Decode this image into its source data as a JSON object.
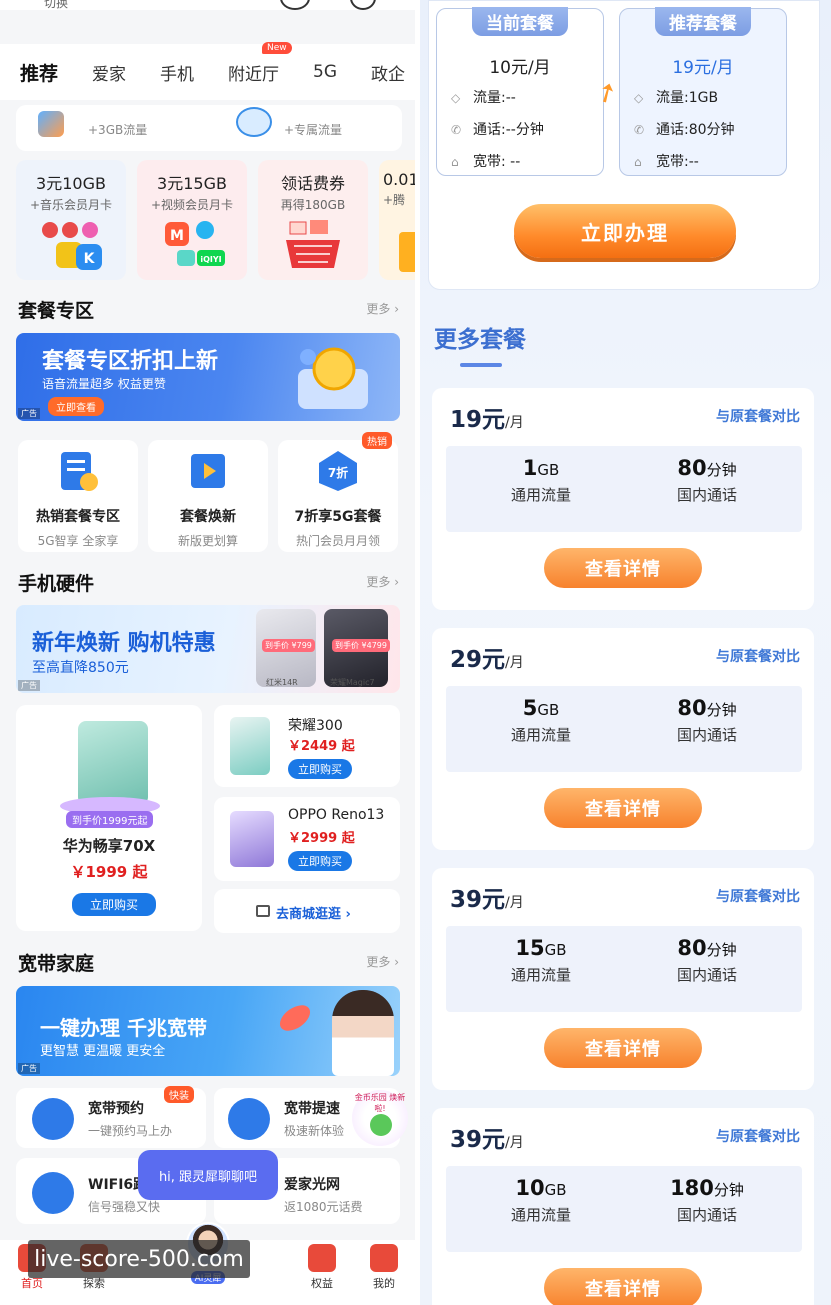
{
  "left": {
    "top": {
      "switch": "切换"
    },
    "tabs": [
      "推荐",
      "爱家",
      "手机",
      "附近厅",
      "5G",
      "政企"
    ],
    "new_badge": "New",
    "promo_row1": {
      "left_sub": "+3GB流量",
      "right_sub": "+专属流量"
    },
    "promo_tiles": [
      {
        "title": "3元10GB",
        "sub": "+音乐会员月卡"
      },
      {
        "title": "3元15GB",
        "sub": "+视频会员月卡"
      },
      {
        "title": "领话费券",
        "sub": "再得180GB"
      },
      {
        "title": "0.01",
        "sub": "+腾"
      }
    ],
    "iqiyi": "iQIYI",
    "plan_section": {
      "title": "套餐专区",
      "more": "更多 ›"
    },
    "plan_banner": {
      "title": "套餐专区折扣上新",
      "sub": "语音流量超多 权益更赞",
      "btn": "立即查看",
      "ad": "广告"
    },
    "services": [
      {
        "name": "热销套餐专区",
        "sub": "5G智享 全家享"
      },
      {
        "name": "套餐焕新",
        "sub": "新版更划算"
      },
      {
        "name": "7折享5G套餐",
        "sub": "热门会员月月领",
        "tag": "热销",
        "icon_text": "7折"
      }
    ],
    "hw_section": {
      "title": "手机硬件",
      "more": "更多 ›"
    },
    "hw_banner": {
      "title": "新年焕新 购机特惠",
      "sub": "至高直降850元",
      "ad": "广告",
      "tag1": "到手价 ¥799",
      "tag2": "到手价 ¥4799",
      "phone1": "红米14R",
      "phone2": "荣耀Magic7"
    },
    "phones": {
      "big": {
        "name": "华为畅享70X",
        "price": "￥1999 起",
        "promo": "到手价1999元起",
        "btn": "立即购买"
      },
      "p1": {
        "name": "荣耀300",
        "price": "￥2449 起",
        "btn": "立即购买"
      },
      "p2": {
        "name": "OPPO Reno13",
        "price": "￥2999 起",
        "btn": "立即购买"
      },
      "mall": "去商城逛逛 ›"
    },
    "bb_section": {
      "title": "宽带家庭",
      "more": "更多 ›"
    },
    "bb_banner": {
      "title": "一键办理 千兆宽带",
      "sub": "更智慧  更温暖  更安全",
      "ad": "广告"
    },
    "bb_items": [
      {
        "name": "宽带预约",
        "sub": "一键预约马上办",
        "tag": "快装"
      },
      {
        "name": "宽带提速",
        "sub": "极速新体验"
      },
      {
        "name": "WIFI6路",
        "sub": "信号强稳又快"
      },
      {
        "name": "爱家光网",
        "sub": "返1080元话费"
      }
    ],
    "gold_tag": "金币乐园 焕新啦!",
    "chat": "hi, 跟灵犀聊聊吧",
    "ai_label": "AI灵犀",
    "bottom_nav": [
      "首页",
      "探索",
      "权益",
      "我的"
    ],
    "watermark": "live-score-500.com"
  },
  "right": {
    "current": {
      "header": "当前套餐",
      "price": "10元/月",
      "flow": "流量:--",
      "call": "通话:--分钟",
      "broadband": "宽带: --"
    },
    "recommended": {
      "header": "推荐套餐",
      "price": "19元/月",
      "flow": "流量:1GB",
      "call": "通话:80分钟",
      "broadband": "宽带:--"
    },
    "apply_btn": "立即办理",
    "more_title": "更多套餐",
    "compare": "与原套餐对比",
    "detail_btn": "查看详情",
    "flow_label": "通用流量",
    "call_label": "国内通话",
    "plans": [
      {
        "price": "19元",
        "unit": "/月",
        "flow": "1",
        "flow_unit": "GB",
        "call": "80",
        "call_unit": "分钟"
      },
      {
        "price": "29元",
        "unit": "/月",
        "flow": "5",
        "flow_unit": "GB",
        "call": "80",
        "call_unit": "分钟"
      },
      {
        "price": "39元",
        "unit": "/月",
        "flow": "15",
        "flow_unit": "GB",
        "call": "80",
        "call_unit": "分钟"
      },
      {
        "price": "39元",
        "unit": "/月",
        "flow": "10",
        "flow_unit": "GB",
        "call": "180",
        "call_unit": "分钟"
      }
    ]
  },
  "colors": {
    "accent_blue": "#1a78e6",
    "orange": "#f7822d",
    "plan_blue": "#3c6fd0",
    "price_red": "#e02020"
  }
}
